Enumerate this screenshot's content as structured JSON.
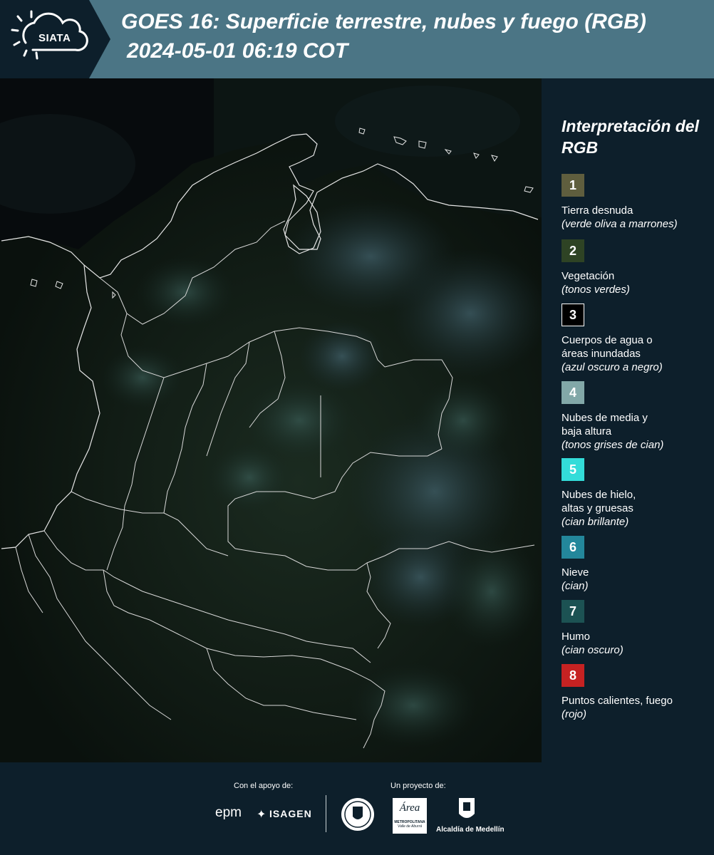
{
  "header": {
    "logo": "SIATA",
    "title_line1": "GOES 16: Superficie terrestre, nubes y fuego (RGB)",
    "title_line2": "2024-05-01 06:19 COT",
    "colors": {
      "header_bg": "#4b7585",
      "logo_bg": "#0d1f2b"
    }
  },
  "map": {
    "description_icon": "satellite-rgb-map"
  },
  "legend": {
    "title": "Interpretación del RGB",
    "items": [
      {
        "num": "1",
        "color": "#5f5e3e",
        "label": "Tierra desnuda",
        "sub": "(verde oliva a marrones)"
      },
      {
        "num": "2",
        "color": "#2e4324",
        "label": "Vegetación",
        "sub": "(tonos verdes)"
      },
      {
        "num": "3",
        "color": "#000000",
        "label": "Cuerpos de agua o\náreas inundadas",
        "sub": "(azul oscuro a negro)"
      },
      {
        "num": "4",
        "color": "#82a8a8",
        "label": "Nubes de media y\nbaja altura",
        "sub": "(tonos grises de cian)"
      },
      {
        "num": "5",
        "color": "#33dcd9",
        "label": "Nubes de hielo,\naltas y gruesas",
        "sub": "(cian brillante)"
      },
      {
        "num": "6",
        "color": "#23879b",
        "label": "Nieve",
        "sub": "(cian)"
      },
      {
        "num": "7",
        "color": "#1c5253",
        "label": "Humo",
        "sub": "(cian oscuro)"
      },
      {
        "num": "8",
        "color": "#c62222",
        "label": "Puntos calientes, fuego",
        "sub": "(rojo)"
      }
    ]
  },
  "footer": {
    "support_label": "Con el apoyo de:",
    "project_label": "Un proyecto de:",
    "epm": "epm",
    "isagen": "ISAGEN",
    "area_top": "Área",
    "area_line1": "METROPOLITANA",
    "area_line2": "Valle de Aburrá",
    "alcaldia": "Alcaldía de Medellín"
  }
}
